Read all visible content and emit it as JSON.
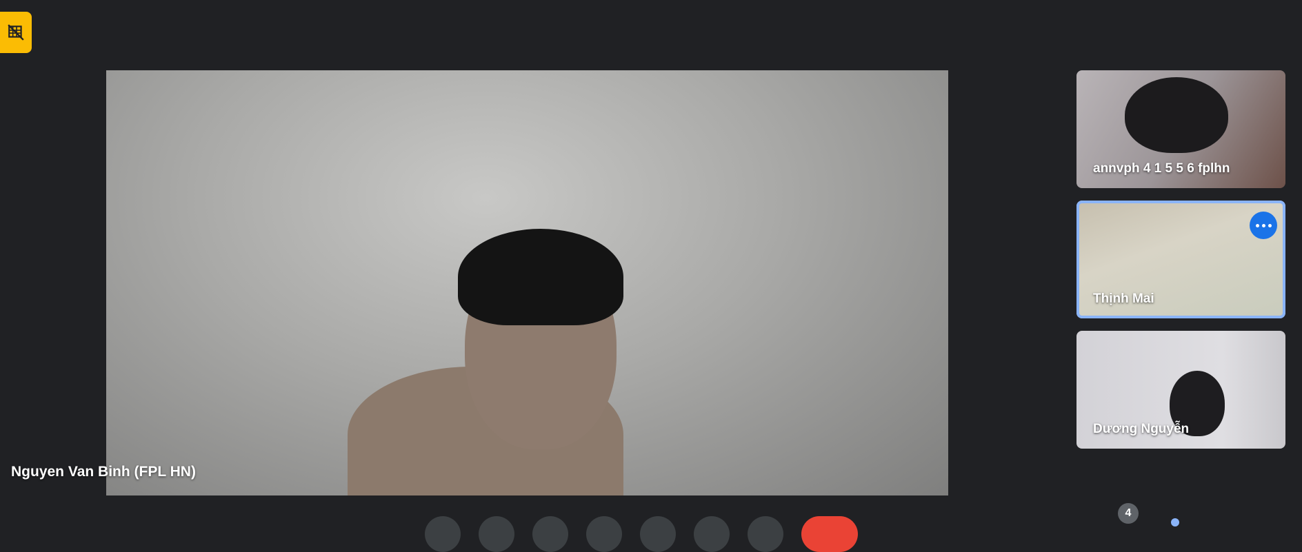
{
  "main_speaker": {
    "name": "Nguyen Van Binh (FPL HN)"
  },
  "participants": [
    {
      "name": "annvph 4 1 5 5 6 fplhn",
      "active": false
    },
    {
      "name": "Thịnh Mai",
      "active": true
    },
    {
      "name": "Dương Nguyễn",
      "active": false
    }
  ],
  "participant_count": "4",
  "icons": {
    "top_left": "no-video-grid-icon",
    "tile_menu": "more-options-icon"
  },
  "colors": {
    "background": "#202124",
    "badge": "#fbbc04",
    "active_outline": "#8ab4f8",
    "menu_button": "#1a73e8",
    "end_call": "#ea4335"
  }
}
